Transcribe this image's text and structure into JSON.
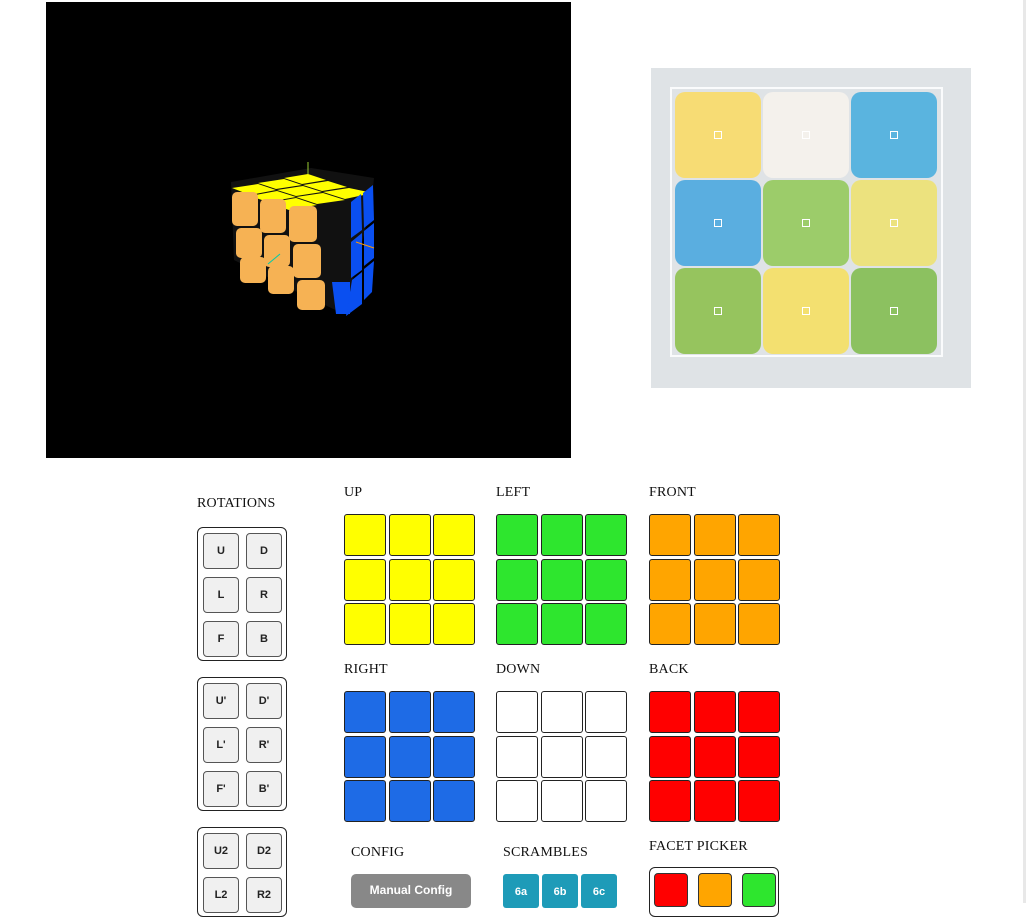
{
  "colors": {
    "yellow": "#ffff00",
    "green": "#2ee62e",
    "orange": "#ffa500",
    "blue": "#1e6be6",
    "white": "#ffffff",
    "red": "#ff0000"
  },
  "rotations": {
    "title": "ROTATIONS",
    "groups": [
      [
        "U",
        "D",
        "L",
        "R",
        "F",
        "B"
      ],
      [
        "U'",
        "D'",
        "L'",
        "R'",
        "F'",
        "B'"
      ],
      [
        "U2",
        "D2",
        "L2",
        "R2"
      ]
    ]
  },
  "faces": [
    {
      "label": "UP",
      "color": "#ffff00"
    },
    {
      "label": "LEFT",
      "color": "#2ee62e"
    },
    {
      "label": "FRONT",
      "color": "#ffa500"
    },
    {
      "label": "RIGHT",
      "color": "#1e6be6"
    },
    {
      "label": "DOWN",
      "color": "#ffffff"
    },
    {
      "label": "BACK",
      "color": "#ff0000"
    }
  ],
  "config": {
    "title": "CONFIG",
    "manual_label": "Manual Config"
  },
  "scrambles": {
    "title": "SCRAMBLES",
    "items": [
      "6a",
      "6b",
      "6c"
    ]
  },
  "facet_picker": {
    "title": "FACET PICKER",
    "colors": [
      "#ff0000",
      "#ffa500",
      "#2ee62e"
    ]
  },
  "camera": {
    "stickers": [
      "#f7dc74",
      "#f4f1ec",
      "#5ab4df",
      "#5aaee0",
      "#9ccc6a",
      "#ece27e",
      "#96c45e",
      "#f3e070",
      "#8cc160"
    ]
  }
}
